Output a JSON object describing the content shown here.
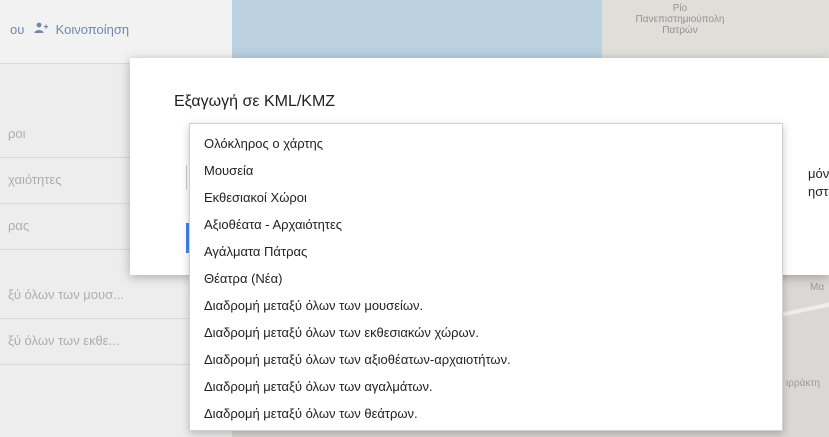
{
  "toolbar": {
    "share_fragment": "ου",
    "share_label": "Κοινοποίηση"
  },
  "layers": [
    {
      "label": "ροι"
    },
    {
      "label": "χαιότητες"
    },
    {
      "label": "ρας"
    },
    {
      "label": "ξύ όλων των μουσ..."
    },
    {
      "label": "ξύ όλων των εκθε..."
    }
  ],
  "map": {
    "place_label_line1": "Πανεπιστημιούπολη",
    "place_label_line2": "Πατρών",
    "top_fragment": "Ρίο",
    "right_fragment_1": "Μα",
    "right_fragment_2": "ιρράκτη"
  },
  "dialog": {
    "title": "Εξαγωγή σε KML/KMZ",
    "right_fragment_1": "μόνο μ",
    "right_fragment_2": "ηστε α"
  },
  "dropdown": {
    "items": [
      "Ολόκληρος ο χάρτης",
      "Μουσεία",
      "Εκθεσιακοί Χώροι",
      "Αξιοθέατα - Αρχαιότητες",
      "Αγάλματα Πάτρας",
      "Θέατρα (Νέα)",
      "Διαδρομή μεταξύ όλων των μουσείων.",
      "Διαδρομή μεταξύ όλων των εκθεσιακών χώρων.",
      "Διαδρομή μεταξύ όλων των αξιοθέατων-αρχαιοτήτων.",
      "Διαδρομή μεταξύ όλων των αγαλμάτων.",
      "Διαδρομή μεταξύ όλων των θεάτρων."
    ]
  }
}
